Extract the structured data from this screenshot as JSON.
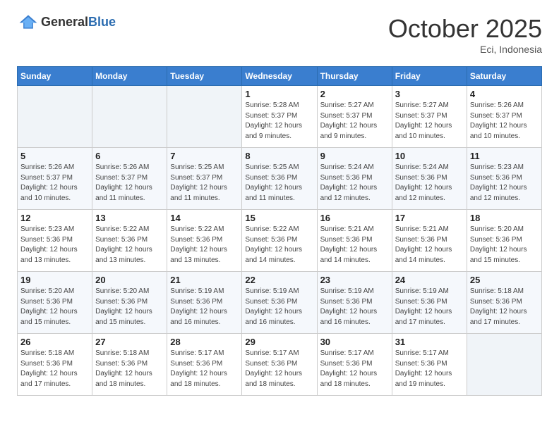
{
  "header": {
    "logo_general": "General",
    "logo_blue": "Blue",
    "month_title": "October 2025",
    "location": "Eci, Indonesia"
  },
  "weekdays": [
    "Sunday",
    "Monday",
    "Tuesday",
    "Wednesday",
    "Thursday",
    "Friday",
    "Saturday"
  ],
  "weeks": [
    [
      {
        "day": "",
        "sunrise": "",
        "sunset": "",
        "daylight": ""
      },
      {
        "day": "",
        "sunrise": "",
        "sunset": "",
        "daylight": ""
      },
      {
        "day": "",
        "sunrise": "",
        "sunset": "",
        "daylight": ""
      },
      {
        "day": "1",
        "sunrise": "Sunrise: 5:28 AM",
        "sunset": "Sunset: 5:37 PM",
        "daylight": "Daylight: 12 hours and 9 minutes."
      },
      {
        "day": "2",
        "sunrise": "Sunrise: 5:27 AM",
        "sunset": "Sunset: 5:37 PM",
        "daylight": "Daylight: 12 hours and 9 minutes."
      },
      {
        "day": "3",
        "sunrise": "Sunrise: 5:27 AM",
        "sunset": "Sunset: 5:37 PM",
        "daylight": "Daylight: 12 hours and 10 minutes."
      },
      {
        "day": "4",
        "sunrise": "Sunrise: 5:26 AM",
        "sunset": "Sunset: 5:37 PM",
        "daylight": "Daylight: 12 hours and 10 minutes."
      }
    ],
    [
      {
        "day": "5",
        "sunrise": "Sunrise: 5:26 AM",
        "sunset": "Sunset: 5:37 PM",
        "daylight": "Daylight: 12 hours and 10 minutes."
      },
      {
        "day": "6",
        "sunrise": "Sunrise: 5:26 AM",
        "sunset": "Sunset: 5:37 PM",
        "daylight": "Daylight: 12 hours and 11 minutes."
      },
      {
        "day": "7",
        "sunrise": "Sunrise: 5:25 AM",
        "sunset": "Sunset: 5:37 PM",
        "daylight": "Daylight: 12 hours and 11 minutes."
      },
      {
        "day": "8",
        "sunrise": "Sunrise: 5:25 AM",
        "sunset": "Sunset: 5:36 PM",
        "daylight": "Daylight: 12 hours and 11 minutes."
      },
      {
        "day": "9",
        "sunrise": "Sunrise: 5:24 AM",
        "sunset": "Sunset: 5:36 PM",
        "daylight": "Daylight: 12 hours and 12 minutes."
      },
      {
        "day": "10",
        "sunrise": "Sunrise: 5:24 AM",
        "sunset": "Sunset: 5:36 PM",
        "daylight": "Daylight: 12 hours and 12 minutes."
      },
      {
        "day": "11",
        "sunrise": "Sunrise: 5:23 AM",
        "sunset": "Sunset: 5:36 PM",
        "daylight": "Daylight: 12 hours and 12 minutes."
      }
    ],
    [
      {
        "day": "12",
        "sunrise": "Sunrise: 5:23 AM",
        "sunset": "Sunset: 5:36 PM",
        "daylight": "Daylight: 12 hours and 13 minutes."
      },
      {
        "day": "13",
        "sunrise": "Sunrise: 5:22 AM",
        "sunset": "Sunset: 5:36 PM",
        "daylight": "Daylight: 12 hours and 13 minutes."
      },
      {
        "day": "14",
        "sunrise": "Sunrise: 5:22 AM",
        "sunset": "Sunset: 5:36 PM",
        "daylight": "Daylight: 12 hours and 13 minutes."
      },
      {
        "day": "15",
        "sunrise": "Sunrise: 5:22 AM",
        "sunset": "Sunset: 5:36 PM",
        "daylight": "Daylight: 12 hours and 14 minutes."
      },
      {
        "day": "16",
        "sunrise": "Sunrise: 5:21 AM",
        "sunset": "Sunset: 5:36 PM",
        "daylight": "Daylight: 12 hours and 14 minutes."
      },
      {
        "day": "17",
        "sunrise": "Sunrise: 5:21 AM",
        "sunset": "Sunset: 5:36 PM",
        "daylight": "Daylight: 12 hours and 14 minutes."
      },
      {
        "day": "18",
        "sunrise": "Sunrise: 5:20 AM",
        "sunset": "Sunset: 5:36 PM",
        "daylight": "Daylight: 12 hours and 15 minutes."
      }
    ],
    [
      {
        "day": "19",
        "sunrise": "Sunrise: 5:20 AM",
        "sunset": "Sunset: 5:36 PM",
        "daylight": "Daylight: 12 hours and 15 minutes."
      },
      {
        "day": "20",
        "sunrise": "Sunrise: 5:20 AM",
        "sunset": "Sunset: 5:36 PM",
        "daylight": "Daylight: 12 hours and 15 minutes."
      },
      {
        "day": "21",
        "sunrise": "Sunrise: 5:19 AM",
        "sunset": "Sunset: 5:36 PM",
        "daylight": "Daylight: 12 hours and 16 minutes."
      },
      {
        "day": "22",
        "sunrise": "Sunrise: 5:19 AM",
        "sunset": "Sunset: 5:36 PM",
        "daylight": "Daylight: 12 hours and 16 minutes."
      },
      {
        "day": "23",
        "sunrise": "Sunrise: 5:19 AM",
        "sunset": "Sunset: 5:36 PM",
        "daylight": "Daylight: 12 hours and 16 minutes."
      },
      {
        "day": "24",
        "sunrise": "Sunrise: 5:19 AM",
        "sunset": "Sunset: 5:36 PM",
        "daylight": "Daylight: 12 hours and 17 minutes."
      },
      {
        "day": "25",
        "sunrise": "Sunrise: 5:18 AM",
        "sunset": "Sunset: 5:36 PM",
        "daylight": "Daylight: 12 hours and 17 minutes."
      }
    ],
    [
      {
        "day": "26",
        "sunrise": "Sunrise: 5:18 AM",
        "sunset": "Sunset: 5:36 PM",
        "daylight": "Daylight: 12 hours and 17 minutes."
      },
      {
        "day": "27",
        "sunrise": "Sunrise: 5:18 AM",
        "sunset": "Sunset: 5:36 PM",
        "daylight": "Daylight: 12 hours and 18 minutes."
      },
      {
        "day": "28",
        "sunrise": "Sunrise: 5:17 AM",
        "sunset": "Sunset: 5:36 PM",
        "daylight": "Daylight: 12 hours and 18 minutes."
      },
      {
        "day": "29",
        "sunrise": "Sunrise: 5:17 AM",
        "sunset": "Sunset: 5:36 PM",
        "daylight": "Daylight: 12 hours and 18 minutes."
      },
      {
        "day": "30",
        "sunrise": "Sunrise: 5:17 AM",
        "sunset": "Sunset: 5:36 PM",
        "daylight": "Daylight: 12 hours and 18 minutes."
      },
      {
        "day": "31",
        "sunrise": "Sunrise: 5:17 AM",
        "sunset": "Sunset: 5:36 PM",
        "daylight": "Daylight: 12 hours and 19 minutes."
      },
      {
        "day": "",
        "sunrise": "",
        "sunset": "",
        "daylight": ""
      }
    ]
  ]
}
